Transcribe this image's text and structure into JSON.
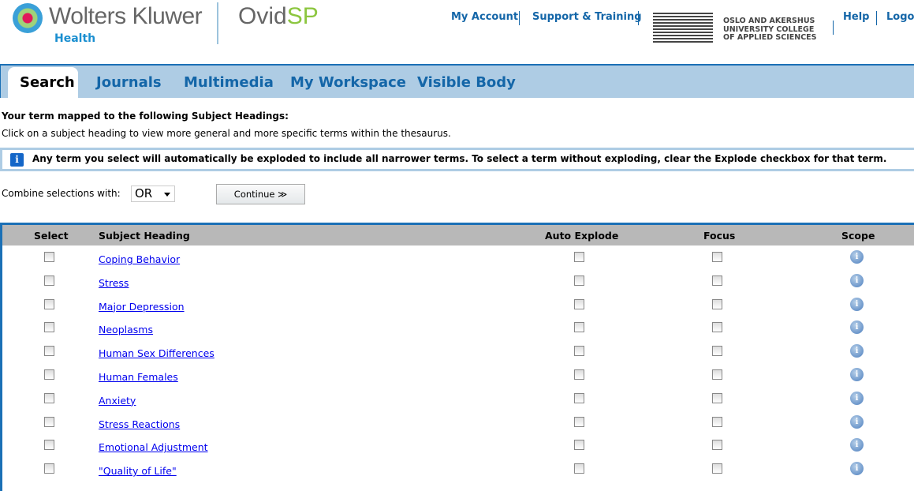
{
  "header": {
    "brand": "Wolters Kluwer",
    "brand_sub": "Health",
    "product_a": "Ovid",
    "product_b": "SP",
    "links": [
      "My Account",
      "Support & Training",
      "Help",
      "Logoff"
    ],
    "institution": [
      "OSLO AND AKERSHUS",
      "UNIVERSITY COLLEGE",
      "OF APPLIED SCIENCES"
    ]
  },
  "tabs": [
    {
      "label": "Search",
      "active": true
    },
    {
      "label": "Journals"
    },
    {
      "label": "Multimedia"
    },
    {
      "label": "My Workspace"
    },
    {
      "label": "Visible Body"
    }
  ],
  "intro": {
    "heading": "Your term mapped to the following Subject Headings:",
    "text": "Click on a subject heading to view more general and more specific terms within the thesaurus.",
    "info": "Any term you select will automatically be exploded to include all narrower terms. To select a term without exploding, clear the Explode checkbox for that term.",
    "info_icon": "i"
  },
  "combine": {
    "label": "Combine selections with:",
    "value": "OR",
    "continue": "Continue ≫"
  },
  "table": {
    "headers": [
      "Select",
      "Subject Heading",
      "Auto Explode",
      "Focus",
      "Scope"
    ],
    "rows": [
      "Coping Behavior",
      "Stress",
      "Major Depression",
      "Neoplasms",
      "Human Sex Differences",
      "Human Females",
      "Anxiety",
      "Stress Reactions",
      "Emotional Adjustment",
      "\"Quality of Life\""
    ],
    "scope_icon": "i"
  },
  "colors": {
    "accent": "#1b70b6",
    "tabbar": "#aecce4",
    "link": "#0000ee",
    "header_row": "#b8b8b8"
  }
}
